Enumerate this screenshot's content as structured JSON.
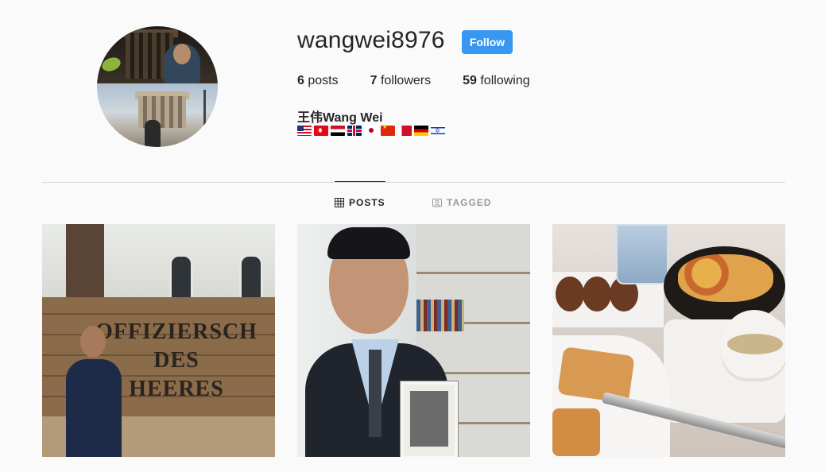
{
  "profile": {
    "username": "wangwei8976",
    "follow_label": "Follow",
    "full_name": "王伟Wang Wei",
    "flags": [
      "us-flag",
      "turkey-flag",
      "egypt-flag",
      "uk-flag",
      "japan-flag",
      "china-flag",
      "bahrain-flag",
      "germany-flag",
      "israel-flag"
    ],
    "stats": [
      {
        "count": "6",
        "label": "posts"
      },
      {
        "count": "7",
        "label": "followers"
      },
      {
        "count": "59",
        "label": "following"
      }
    ]
  },
  "tabs": [
    {
      "label": "POSTS",
      "icon": "grid-icon",
      "active": true
    },
    {
      "label": "TAGGED",
      "icon": "tag-icon",
      "active": false
    }
  ],
  "posts": [
    {
      "sign_text": [
        "OFFIZIERSCH",
        "DES",
        "HEERES"
      ]
    },
    {},
    {}
  ],
  "colors": {
    "accent": "#3897f0",
    "text": "#262626",
    "muted": "#999999",
    "background": "#fafafa",
    "divider": "#dbdbdb"
  }
}
